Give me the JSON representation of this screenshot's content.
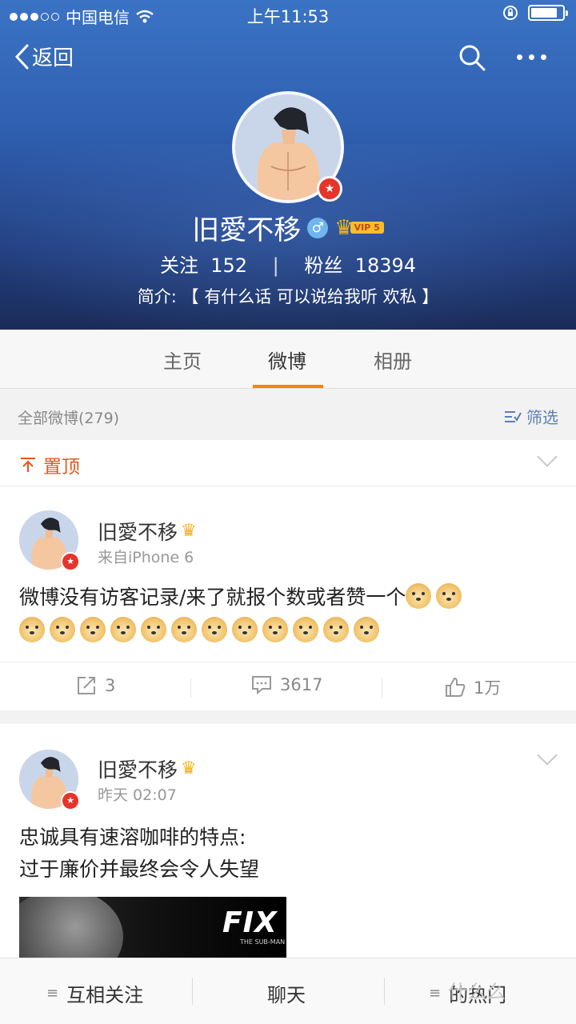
{
  "status_bar": {
    "carrier": "中国电信",
    "time": "上午11:53",
    "battery_level": 0.85
  },
  "nav": {
    "back_label": "返回"
  },
  "profile": {
    "name": "旧愛不移",
    "gender_symbol": "♂",
    "vip_label": "VIP 5",
    "following_label": "关注",
    "following_count": "152",
    "followers_label": "粉丝",
    "followers_count": "18394",
    "bio": "简介: 【 有什么话 可以说给我听  欢私 】"
  },
  "tabs": [
    {
      "label": "主页"
    },
    {
      "label": "微博"
    },
    {
      "label": "相册"
    }
  ],
  "filter": {
    "title": "全部微博(279)",
    "button_label": "筛选"
  },
  "pinned": {
    "label": "置顶"
  },
  "posts": [
    {
      "author": "旧愛不移",
      "source": "来自iPhone 6",
      "text": "微博没有访客记录/来了就报个数或者赞一个",
      "emoji_count": 14,
      "reposts": "3",
      "comments": "3617",
      "likes": "1万"
    },
    {
      "author": "旧愛不移",
      "source": "昨天 02:07",
      "text_line1": "忠诚具有速溶咖啡的特点:",
      "text_line2": "过于廉价并最终会令人失望",
      "image_logo": "FIX",
      "image_sub": "THE SUB-MAN"
    }
  ],
  "bottom_bar": {
    "items": [
      {
        "label": "互相关注"
      },
      {
        "label": "聊天"
      },
      {
        "label": "的热门"
      }
    ],
    "watermark": "什么么"
  },
  "colors": {
    "accent": "#ff8200",
    "pin": "#e8541e",
    "link": "#5b7fb5",
    "header_top": "#3b73c4",
    "header_bottom": "#1a2b57"
  }
}
